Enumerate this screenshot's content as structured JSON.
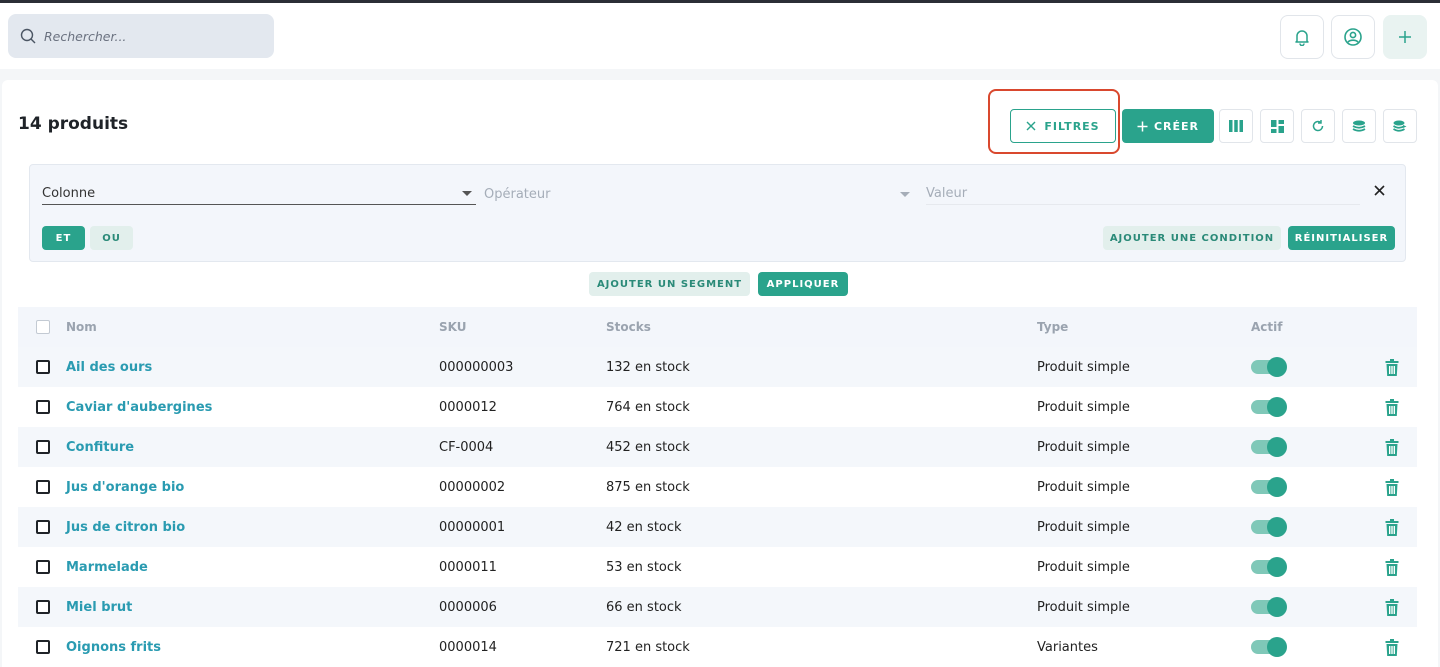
{
  "search": {
    "placeholder": "Rechercher..."
  },
  "header_icons": [
    "bell-icon",
    "user-circle-icon",
    "plus-icon"
  ],
  "page": {
    "title": "14 produits"
  },
  "toolbar": {
    "filters_label": "FILTRES",
    "create_label": "CRÉER",
    "icons": [
      "columns-icon",
      "grid-icon",
      "refresh-icon",
      "import-icon",
      "export-icon"
    ]
  },
  "filter_panel": {
    "column_label": "Colonne",
    "operator_label": "Opérateur",
    "value_label": "Valeur",
    "and_label": "ET",
    "or_label": "OU",
    "add_condition_label": "AJOUTER UNE CONDITION",
    "reset_label": "RÉINITIALISER"
  },
  "segment": {
    "add_segment_label": "AJOUTER UN SEGMENT",
    "apply_label": "APPLIQUER"
  },
  "table": {
    "headers": {
      "name": "Nom",
      "sku": "SKU",
      "stocks": "Stocks",
      "type": "Type",
      "active": "Actif"
    },
    "rows": [
      {
        "name": "Ail des ours",
        "sku": "000000003",
        "stock": "132 en stock",
        "type": "Produit simple",
        "active": true
      },
      {
        "name": "Caviar d'aubergines",
        "sku": "0000012",
        "stock": "764 en stock",
        "type": "Produit simple",
        "active": true
      },
      {
        "name": "Confiture",
        "sku": "CF-0004",
        "stock": "452 en stock",
        "type": "Produit simple",
        "active": true
      },
      {
        "name": "Jus d'orange bio",
        "sku": "00000002",
        "stock": "875 en stock",
        "type": "Produit simple",
        "active": true
      },
      {
        "name": "Jus de citron bio",
        "sku": "00000001",
        "stock": "42 en stock",
        "type": "Produit simple",
        "active": true
      },
      {
        "name": "Marmelade",
        "sku": "0000011",
        "stock": "53 en stock",
        "type": "Produit simple",
        "active": true
      },
      {
        "name": "Miel brut",
        "sku": "0000006",
        "stock": "66 en stock",
        "type": "Produit simple",
        "active": true
      },
      {
        "name": "Oignons frits",
        "sku": "0000014",
        "stock": "721 en stock",
        "type": "Variantes",
        "active": true
      }
    ]
  },
  "colors": {
    "accent": "#2aa38c",
    "link": "#2a9bb1",
    "highlight": "#d9482e"
  }
}
